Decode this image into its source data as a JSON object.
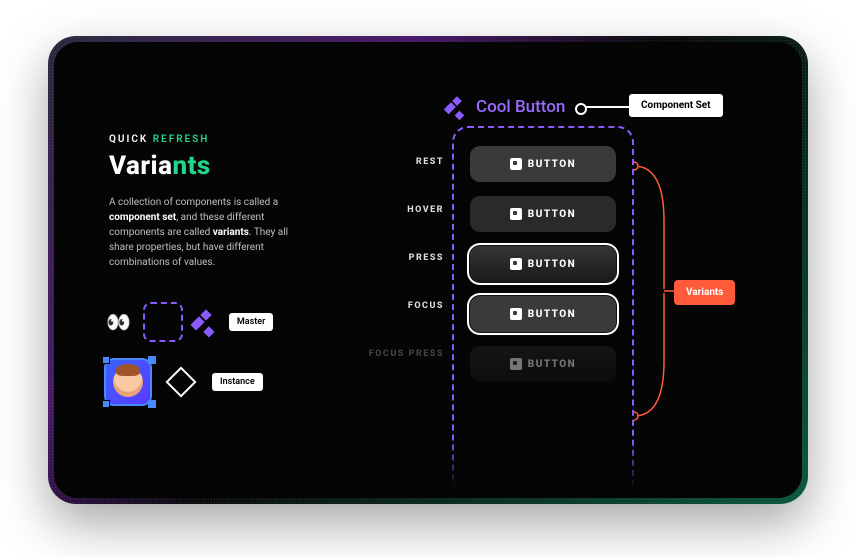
{
  "eyebrow": {
    "part1": "QUICK ",
    "part2": "REFRESH"
  },
  "title": {
    "part1": "Varia",
    "part2": "nts"
  },
  "description": {
    "pre": "A collection of components is called a ",
    "b1": "component set",
    "mid1": ", and these different components are called ",
    "b2": "variants",
    "post": ". They all share properties, but have different combinations of values."
  },
  "icon_tags": {
    "master": "Master",
    "instance": "Instance"
  },
  "states": [
    "REST",
    "HOVER",
    "PRESS",
    "FOCUS",
    "FOCUS PRESS"
  ],
  "component_set": {
    "title": "Cool Button",
    "annotation": "Component Set"
  },
  "button_label": "BUTTON",
  "variants_annotation": "Variants",
  "colors": {
    "purple": "#8a5cff",
    "green": "#1fd68a",
    "orange": "#ff5a3a"
  }
}
